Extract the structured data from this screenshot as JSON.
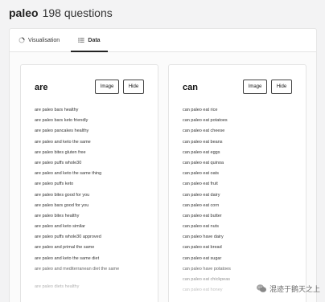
{
  "header": {
    "keyword": "paleo",
    "count": "198 questions"
  },
  "tabs": [
    {
      "label": "Visualisation",
      "icon": "loading-circle-icon",
      "active": false
    },
    {
      "label": "Data",
      "icon": "list-icon",
      "active": true
    }
  ],
  "cards": [
    {
      "title": "are",
      "image_label": "Image",
      "hide_label": "Hide",
      "questions": [
        "are paleo bars healthy",
        "are paleo bars keto friendly",
        "are paleo pancakes healthy",
        "are paleo and keto the same",
        "are paleo bites gluten free",
        "are paleo puffs whole30",
        "are paleo and keto the same thing",
        "are paleo puffs keto",
        "are paleo bites good for you",
        "are paleo bars good for you",
        "are paleo bites healthy",
        "are paleo and keto similar",
        "are paleo puffs whole30 approved",
        "are paleo and primal the same",
        "are paleo and keto the same diet",
        "are paleo and mediterranean diet the same",
        "are paleo diets healthy"
      ]
    },
    {
      "title": "can",
      "image_label": "Image",
      "hide_label": "Hide",
      "questions": [
        "can paleo eat rice",
        "can paleo eat potatoes",
        "can paleo eat cheese",
        "can paleo eat beans",
        "can paleo eat eggs",
        "can paleo eat quinoa",
        "can paleo eat oats",
        "can paleo eat fruit",
        "can paleo eat dairy",
        "can paleo eat corn",
        "can paleo eat butter",
        "can paleo eat nuts",
        "can paleo have dairy",
        "can paleo eat bread",
        "can paleo eat sugar",
        "can paleo have potatoes",
        "can paleo eat chickpeas",
        "can paleo eat honey"
      ]
    }
  ],
  "watermark": {
    "text": "混迹于鹅天之上",
    "icon": "wechat-icon"
  }
}
